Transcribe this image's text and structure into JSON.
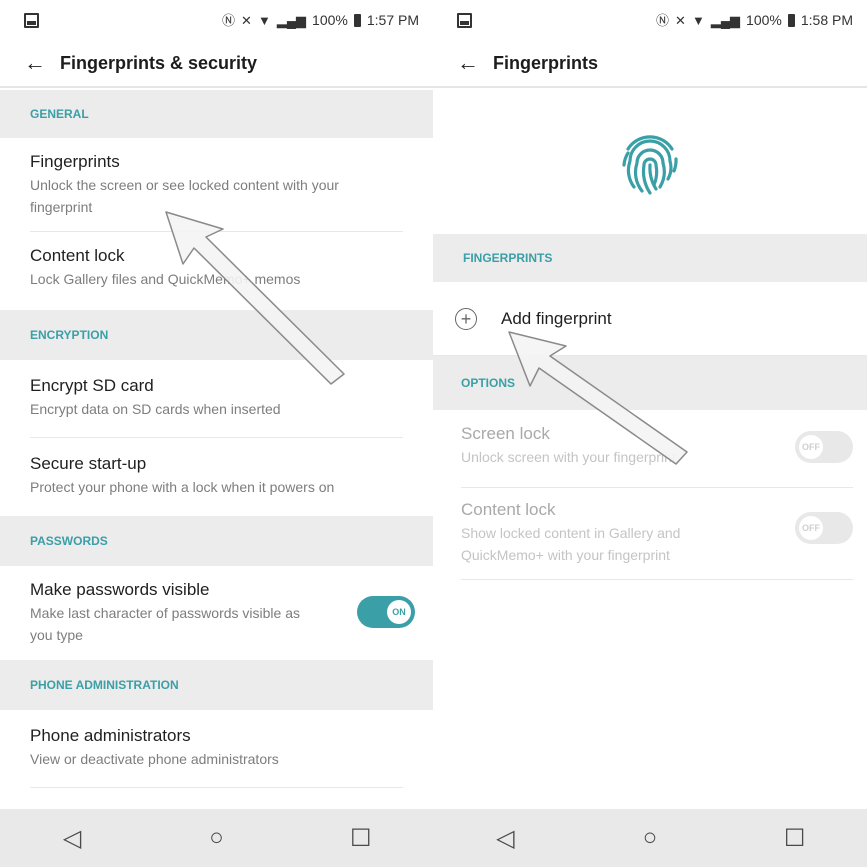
{
  "left": {
    "status": {
      "time": "1:57 PM",
      "battery": "100%"
    },
    "appbar": {
      "title": "Fingerprints & security"
    },
    "sections": {
      "general": "GENERAL",
      "encryption": "ENCRYPTION",
      "passwords": "PASSWORDS",
      "phone_admin": "PHONE ADMINISTRATION"
    },
    "items": {
      "fingerprints": {
        "title": "Fingerprints",
        "subtitle": "Unlock the screen or see locked content with your fingerprint"
      },
      "content_lock": {
        "title": "Content lock",
        "subtitle": "Lock Gallery files and QuickMemo+ memos"
      },
      "encrypt_sd": {
        "title": "Encrypt SD card",
        "subtitle": "Encrypt data on SD cards when inserted"
      },
      "secure_startup": {
        "title": "Secure start-up",
        "subtitle": "Protect your phone with a lock when it powers on"
      },
      "make_passwords_visible": {
        "title": "Make passwords visible",
        "subtitle": "Make last character of passwords visible as you type",
        "toggle": "ON"
      },
      "phone_administrators": {
        "title": "Phone administrators",
        "subtitle": "View or deactivate phone administrators"
      }
    }
  },
  "right": {
    "status": {
      "time": "1:58 PM",
      "battery": "100%"
    },
    "appbar": {
      "title": "Fingerprints"
    },
    "sections": {
      "fingerprints": "FINGERPRINTS",
      "options": "OPTIONS"
    },
    "add_fingerprint": "Add fingerprint",
    "options": {
      "screen_lock": {
        "title": "Screen lock",
        "subtitle": "Unlock screen with your fingerprint",
        "toggle": "OFF"
      },
      "content_lock": {
        "title": "Content lock",
        "subtitle": "Show locked content in Gallery and QuickMemo+ with your fingerprint",
        "toggle": "OFF"
      }
    }
  },
  "icons": {
    "back": "arrow-left",
    "fingerprint": "fingerprint",
    "add": "plus-circle",
    "nav_back": "triangle-back",
    "nav_home": "circle-home",
    "nav_recents": "square-recents"
  },
  "colors": {
    "accent": "#3a9fa6",
    "section_bg": "#ececec",
    "navbar_bg": "#e9e9e9"
  }
}
